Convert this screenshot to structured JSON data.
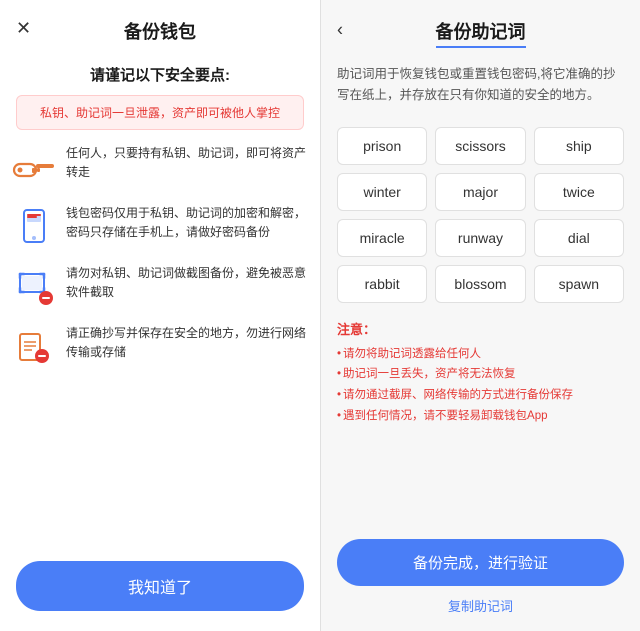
{
  "left": {
    "close_icon": "✕",
    "title": "备份钱包",
    "subtitle": "请谨记以下安全要点:",
    "warning": "私钥、助记词一旦泄露，资产即可被他人掌控",
    "security_items": [
      {
        "icon": "🔑",
        "text": "任何人，只要持有私钥、助记词，即可将资产转走"
      },
      {
        "icon": "📱",
        "text": "钱包密码仅用于私钥、助记词的加密和解密，密码只存储在手机上，请做好密码备份"
      },
      {
        "icon": "🖼",
        "text": "请勿对私钥、助记词做截图备份，避免被恶意软件截取"
      },
      {
        "icon": "📋",
        "text": "请正确抄写并保存在安全的地方，勿进行网络传输或存储"
      }
    ],
    "btn_label": "我知道了"
  },
  "right": {
    "back_icon": "‹",
    "title": "备份助记词",
    "description": "助记词用于恢复钱包或重置钱包密码,将它准确的抄写在纸上，并存放在只有你知道的安全的地方。",
    "words": [
      "prison",
      "scissors",
      "ship",
      "winter",
      "major",
      "twice",
      "miracle",
      "runway",
      "dial",
      "rabbit",
      "blossom",
      "spawn"
    ],
    "notes_title": "注意：",
    "notes": [
      "请勿将助记词透露给任何人",
      "助记词一旦丢失，资产将无法恢复",
      "请勿通过截屏、网络传输的方式进行备份保存",
      "遇到任何情况，请不要轻易卸载钱包App"
    ],
    "btn_label": "备份完成，进行验证",
    "copy_label": "复制助记词"
  }
}
